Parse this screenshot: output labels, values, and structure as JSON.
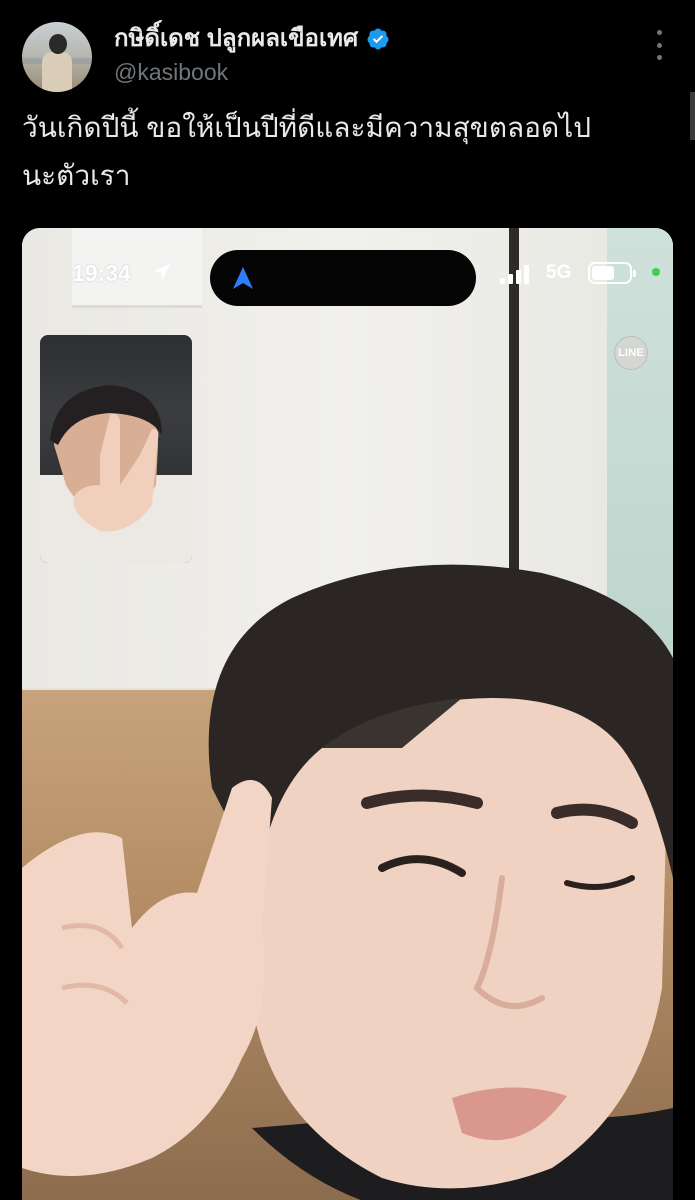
{
  "tweet": {
    "display_name": "กษิดิ์เดช ปลูกผลเขือเทศ",
    "handle": "@kasibook",
    "text": "วันเกิดปีนี้ ขอให้เป็นปีที่ดีและมีความสุขตลอดไป\nนะตัวเรา",
    "verified": true
  },
  "media": {
    "status_bar": {
      "time": "19:34",
      "network": "5G",
      "battery_level": 0.6
    },
    "line_badge": "LINE"
  },
  "colors": {
    "background": "#000000",
    "text_primary": "#e7e9ea",
    "text_secondary": "#71767b",
    "verified_blue": "#1d9bf0",
    "nav_arrow_blue": "#2f7dff",
    "camera_indicator": "#37d34a"
  },
  "icons": {
    "verified": "verified-badge-icon",
    "more": "more-vertical-icon",
    "location": "location-arrow-icon",
    "nav": "navigation-arrow-icon",
    "signal": "cellular-signal-icon",
    "battery": "battery-icon"
  }
}
